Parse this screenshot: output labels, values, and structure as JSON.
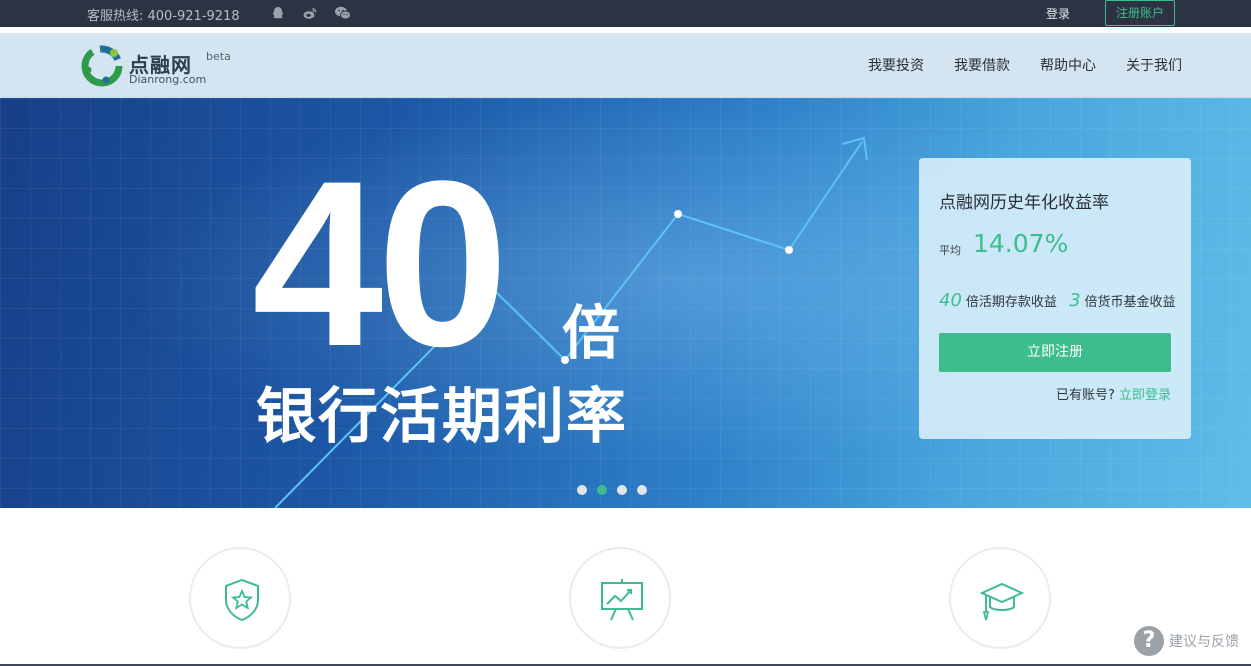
{
  "topbar": {
    "hotline": "客服热线:  400-921-9218",
    "login": "登录",
    "register": "注册账户"
  },
  "header": {
    "logo_cn": "点融网",
    "logo_en": "Dianrong.com",
    "logo_badge": "beta",
    "nav": [
      "我要投资",
      "我要借款",
      "帮助中心",
      "关于我们"
    ]
  },
  "hero": {
    "big_number": "40",
    "multiplier": "倍",
    "subtitle": "银行活期利率",
    "slides": 4,
    "active_slide": 2
  },
  "rate_card": {
    "title": "点融网历史年化收益率",
    "avg_label": "平均",
    "avg_value": "14.07%",
    "compare_1_num": "40",
    "compare_1_text": "倍活期存款收益",
    "compare_2_num": "3",
    "compare_2_text": "倍货币基金收益",
    "cta": "立即注册",
    "login_prompt": "已有账号?",
    "login_link": "立即登录"
  },
  "feedback": {
    "label": "建议与反馈"
  },
  "colors": {
    "accent": "#3dbd8d",
    "topbar": "#2c3443",
    "header": "#d4e5f1"
  }
}
